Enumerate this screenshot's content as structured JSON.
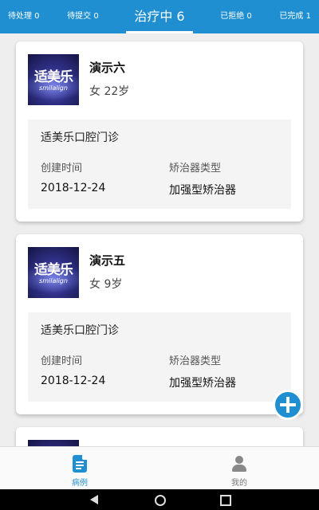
{
  "tabs": [
    {
      "label": "待处理 0"
    },
    {
      "label": "待提交 0"
    },
    {
      "label": "治疗中 6"
    },
    {
      "label": "已拒绝 0"
    },
    {
      "label": "已完成 1"
    }
  ],
  "logo": {
    "cn": "适美乐",
    "en": "smilalign"
  },
  "cards": [
    {
      "name": "演示六",
      "gender_age": "女 22岁",
      "clinic": "适美乐口腔门诊",
      "created_label": "创建时间",
      "created_value": "2018-12-24",
      "type_label": "矫治器类型",
      "type_value": "加强型矫治器"
    },
    {
      "name": "演示五",
      "gender_age": "女 9岁",
      "clinic": "适美乐口腔门诊",
      "created_label": "创建时间",
      "created_value": "2018-12-24",
      "type_label": "矫治器类型",
      "type_value": "加强型矫治器"
    }
  ],
  "bottom_nav": [
    {
      "label": "病例",
      "icon": "document-icon"
    },
    {
      "label": "我的",
      "icon": "user-icon"
    }
  ],
  "colors": {
    "accent": "#1f8fd1"
  }
}
